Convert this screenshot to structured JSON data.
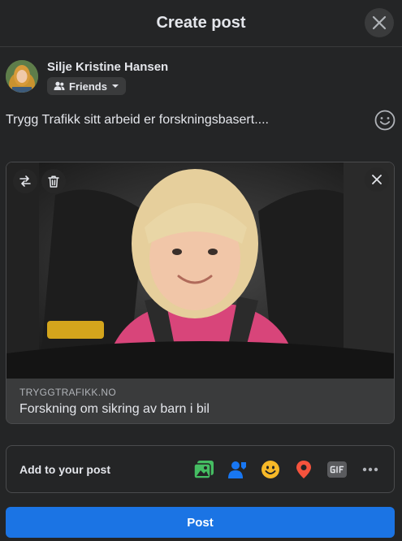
{
  "header": {
    "title": "Create post",
    "close_icon": "close-icon"
  },
  "composer": {
    "user_name": "Silje Kristine Hansen",
    "audience": "Friends",
    "audience_icon": "friends-icon",
    "text": "Trygg Trafikk sitt arbeid er forskningsbasert....",
    "emoji_icon": "smiley-icon"
  },
  "link_preview": {
    "domain": "TRYGGTRAFIKK.NO",
    "title": "Forskning om sikring av barn i bil",
    "image_icons": [
      "swap-icon",
      "trash-icon",
      "close-icon"
    ]
  },
  "add_to_post": {
    "label": "Add to your post",
    "icons": [
      {
        "name": "photo-video-icon",
        "color": "#45bd62"
      },
      {
        "name": "tag-people-icon",
        "color": "#1877f2"
      },
      {
        "name": "feeling-activity-icon",
        "color": "#f7b928"
      },
      {
        "name": "check-in-icon",
        "color": "#f5533d"
      },
      {
        "name": "gif-icon",
        "color": "#5a5b5e"
      },
      {
        "name": "more-icon",
        "color": "#b0b3b8"
      }
    ]
  },
  "post_button": {
    "label": "Post",
    "color": "#1b74e4"
  }
}
